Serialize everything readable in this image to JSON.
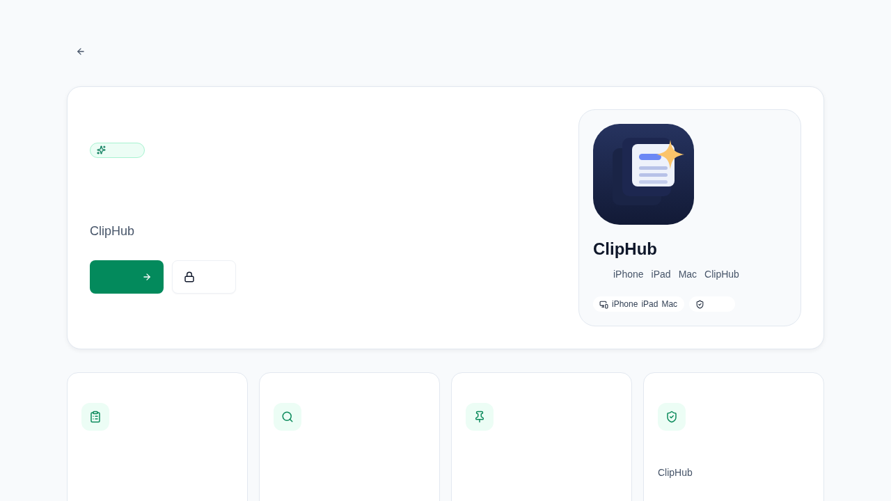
{
  "hero": {
    "tagline": "ClipHub",
    "buttons": [
      {
        "kind": "primary"
      },
      {
        "kind": "secondary"
      }
    ]
  },
  "app_card": {
    "name": "ClipHub",
    "subtitle_parts": [
      "iPhone",
      "iPad",
      "Mac",
      "ClipHub"
    ],
    "chips": [
      {
        "kind": "devices",
        "labels": [
          "iPhone",
          "iPad",
          "Mac"
        ]
      },
      {
        "kind": "privacy"
      }
    ]
  },
  "features": [
    {
      "kind": "clipboard"
    },
    {
      "kind": "search"
    },
    {
      "kind": "pin"
    },
    {
      "kind": "privacy",
      "text": "ClipHub"
    }
  ]
}
